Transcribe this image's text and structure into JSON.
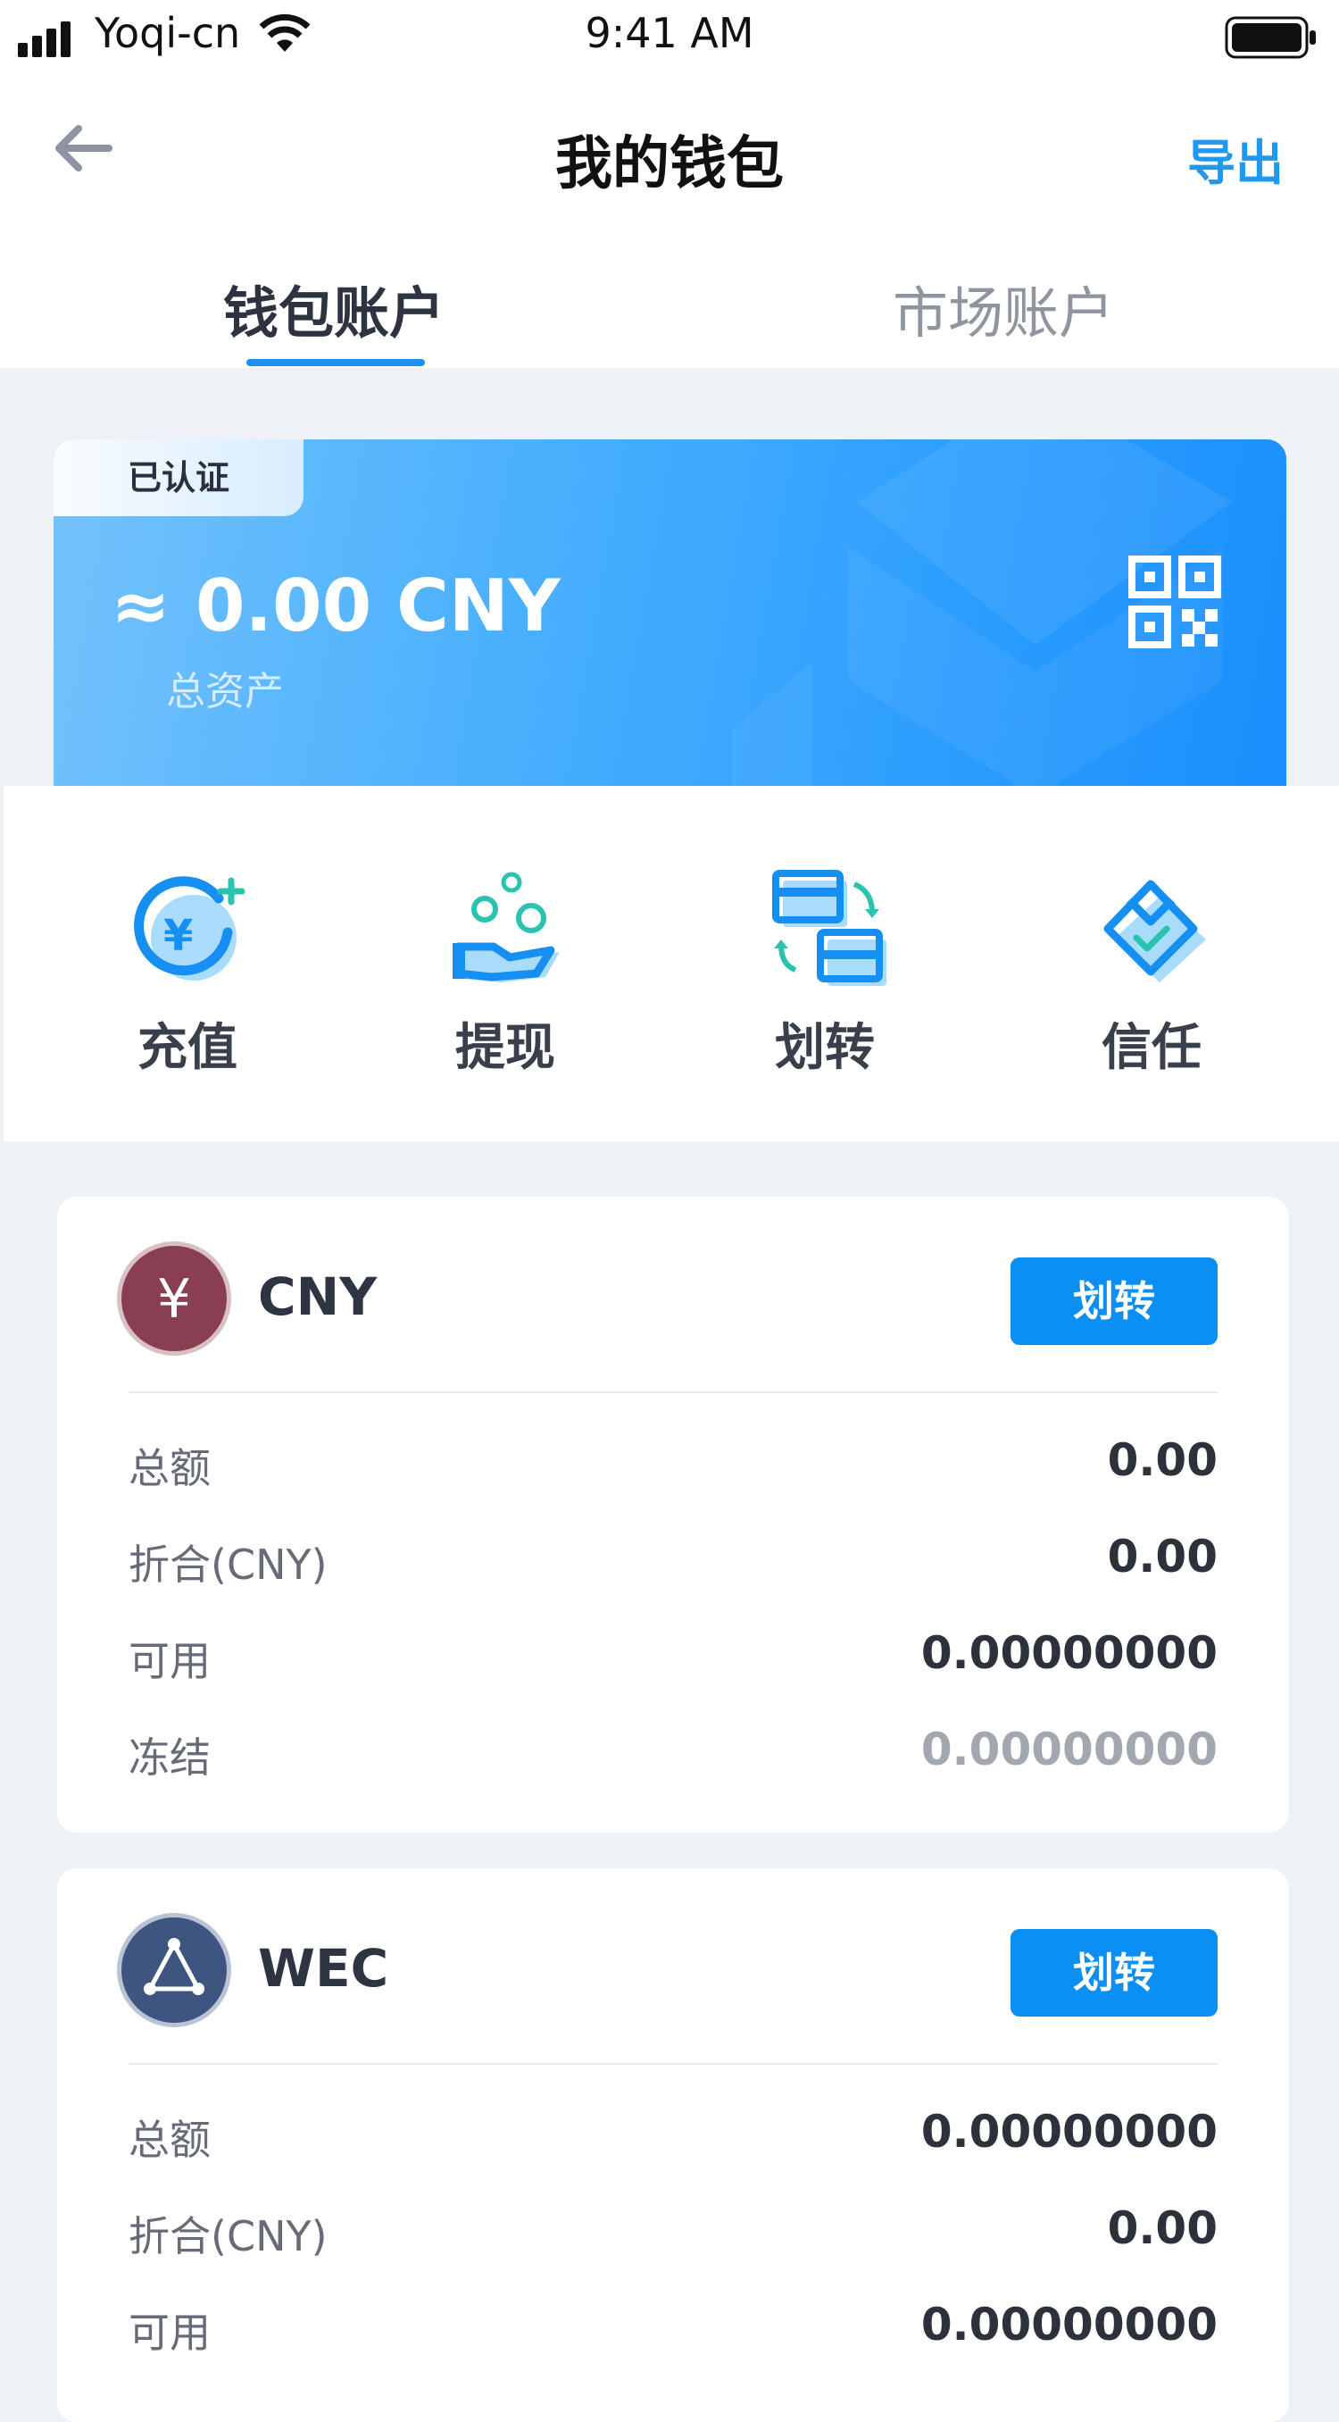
{
  "status_bar": {
    "carrier": "Yoqi-cn",
    "time": "9:41 AM"
  },
  "header": {
    "title": "我的钱包",
    "export_label": "导出"
  },
  "tabs": [
    {
      "label": "钱包账户",
      "active": true
    },
    {
      "label": "市场账户",
      "active": false
    }
  ],
  "summary": {
    "badge": "已认证",
    "total": "≈ 0.00 CNY",
    "total_label": "总资产"
  },
  "actions": [
    {
      "label": "充值",
      "icon": "recharge-icon"
    },
    {
      "label": "提现",
      "icon": "withdraw-icon"
    },
    {
      "label": "划转",
      "icon": "transfer-icon"
    },
    {
      "label": "信任",
      "icon": "trust-icon"
    }
  ],
  "assets": [
    {
      "name": "CNY",
      "icon": "yuan-coin-icon",
      "button": "划转",
      "rows": [
        {
          "label": "总额",
          "value": "0.00"
        },
        {
          "label": "折合(CNY)",
          "value": "0.00"
        },
        {
          "label": "可用",
          "value": "0.00000000"
        },
        {
          "label": "冻结",
          "value": "0.00000000"
        }
      ]
    },
    {
      "name": "WEC",
      "icon": "wec-coin-icon",
      "button": "划转",
      "rows": [
        {
          "label": "总额",
          "value": "0.00000000"
        },
        {
          "label": "折合(CNY)",
          "value": "0.00"
        },
        {
          "label": "可用",
          "value": "0.00000000"
        }
      ]
    }
  ],
  "colors": {
    "accent": "#0c8ff2",
    "cny_coin": "#8a3e52",
    "wec_coin": "#3d5580"
  }
}
